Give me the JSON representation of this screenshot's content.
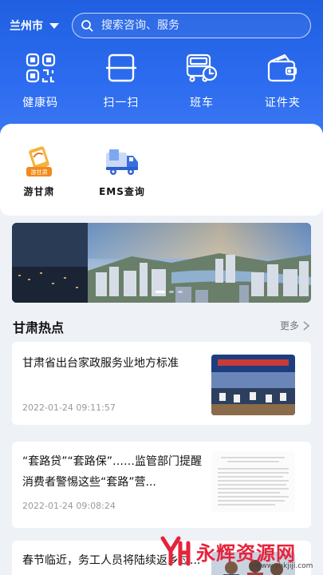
{
  "header": {
    "city": "兰州市",
    "search_placeholder": "搜索咨询、服务"
  },
  "quick_actions": [
    {
      "label": "健康码",
      "icon": "qr-code-icon"
    },
    {
      "label": "扫一扫",
      "icon": "scan-icon"
    },
    {
      "label": "班车",
      "icon": "bus-icon"
    },
    {
      "label": "证件夹",
      "icon": "wallet-icon"
    }
  ],
  "services": [
    {
      "label": "游甘肃",
      "icon": "travel-gansu-icon"
    },
    {
      "label": "EMS查询",
      "icon": "ems-truck-icon"
    }
  ],
  "banner": {
    "pages": 3,
    "active": 0
  },
  "hot": {
    "title": "甘肃热点",
    "more": "更多",
    "items": [
      {
        "title": "甘肃省出台家政服务业地方标准",
        "time": "2022-01-24 09:11:57"
      },
      {
        "title": "“套路贷”“套路保”……监管部门提醒消费者警惕这些“套路”营...",
        "time": "2022-01-24 09:08:24"
      },
      {
        "title": "春节临近，务工人员将陆续返乡过...",
        "time": ""
      }
    ]
  },
  "watermark": {
    "text": "永辉资源网",
    "url": "www.yhkjiji.com"
  },
  "colors": {
    "primary": "#2d6cf0",
    "accent_orange": "#f08a1c",
    "watermark_red": "#e6233c"
  }
}
